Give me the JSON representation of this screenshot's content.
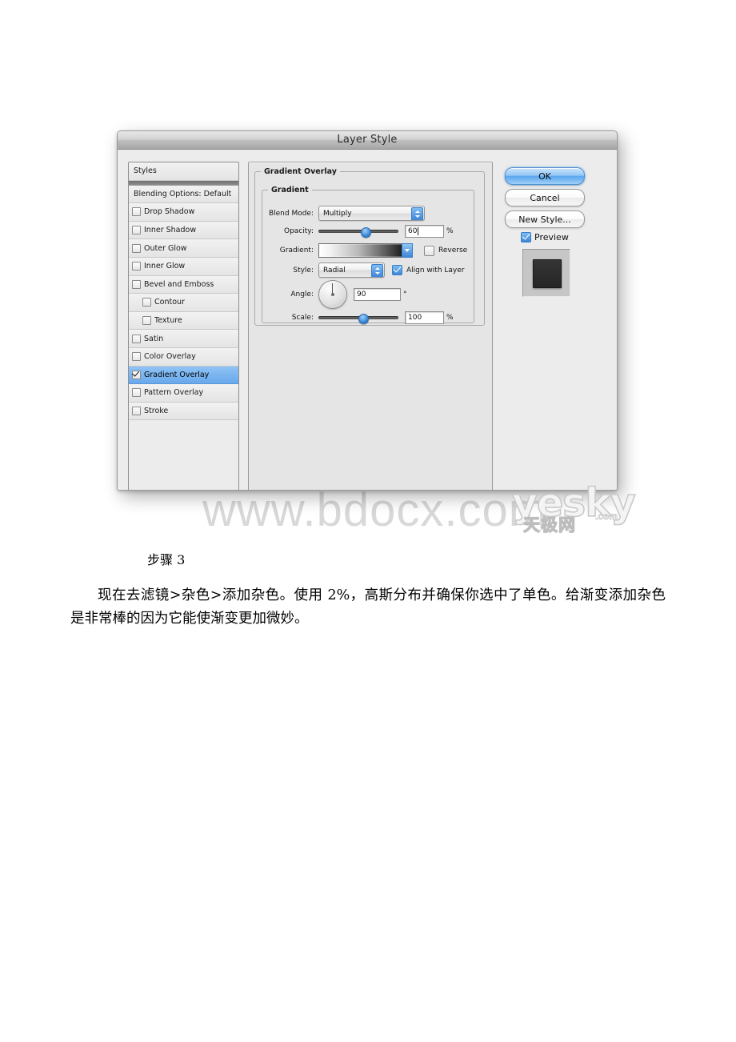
{
  "document": {
    "step_title": "步骤 3",
    "step_body": "现在去滤镜>杂色>添加杂色。使用 2%，高斯分布并确保你选中了单色。给渐变添加杂色是非常棒的因为它能使渐变更加微妙。"
  },
  "watermarks": {
    "bdocx": "www.bdocx.com",
    "yesky_main": "yesky",
    "yesky_com": ".com",
    "yesky_cn": "天极网"
  },
  "dialog": {
    "title": "Layer Style",
    "styles_list": [
      {
        "label": "Styles",
        "type": "plain"
      },
      {
        "label": "Blending Options: Default",
        "type": "plain"
      },
      {
        "label": "Drop Shadow",
        "type": "checkbox",
        "checked": false,
        "indent": false
      },
      {
        "label": "Inner Shadow",
        "type": "checkbox",
        "checked": false,
        "indent": false
      },
      {
        "label": "Outer Glow",
        "type": "checkbox",
        "checked": false,
        "indent": false
      },
      {
        "label": "Inner Glow",
        "type": "checkbox",
        "checked": false,
        "indent": false
      },
      {
        "label": "Bevel and Emboss",
        "type": "checkbox",
        "checked": false,
        "indent": false
      },
      {
        "label": "Contour",
        "type": "checkbox",
        "checked": false,
        "indent": true
      },
      {
        "label": "Texture",
        "type": "checkbox",
        "checked": false,
        "indent": true
      },
      {
        "label": "Satin",
        "type": "checkbox",
        "checked": false,
        "indent": false
      },
      {
        "label": "Color Overlay",
        "type": "checkbox",
        "checked": false,
        "indent": false
      },
      {
        "label": "Gradient Overlay",
        "type": "checkbox",
        "checked": true,
        "indent": false,
        "selected": true
      },
      {
        "label": "Pattern Overlay",
        "type": "checkbox",
        "checked": false,
        "indent": false
      },
      {
        "label": "Stroke",
        "type": "checkbox",
        "checked": false,
        "indent": false
      }
    ],
    "panel": {
      "group_title": "Gradient Overlay",
      "subgroup_title": "Gradient",
      "blend_mode": {
        "label": "Blend Mode:",
        "value": "Multiply"
      },
      "opacity": {
        "label": "Opacity:",
        "value": "60",
        "unit": "%",
        "percent": 60
      },
      "gradient": {
        "label": "Gradient:",
        "from_color": "#ffffff",
        "to_color": "#0d0d0d"
      },
      "reverse": {
        "label": "Reverse",
        "checked": false
      },
      "style": {
        "label": "Style:",
        "value": "Radial"
      },
      "align_with_layer": {
        "label": "Align with Layer",
        "checked": true
      },
      "angle": {
        "label": "Angle:",
        "value": "90",
        "unit": "°"
      },
      "scale": {
        "label": "Scale:",
        "value": "100",
        "unit": "%",
        "percent": 56
      }
    },
    "buttons": {
      "ok": "OK",
      "cancel": "Cancel",
      "new_style": "New Style..."
    },
    "preview": {
      "label": "Preview",
      "checked": true
    }
  },
  "colors": {
    "accent_blue": "#3d86d7",
    "selection_blue": "#67a8ec",
    "dialog_bg": "#ececec",
    "titlebar_dark": "#a6a6a6"
  }
}
